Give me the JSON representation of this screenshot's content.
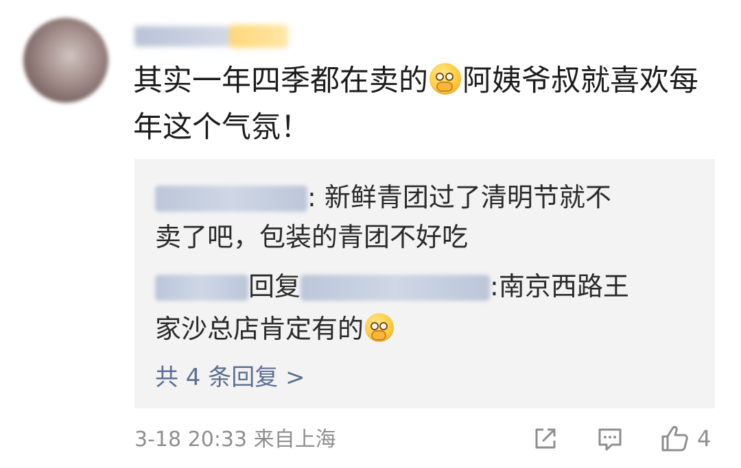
{
  "comment": {
    "username": "",
    "text_part1": "其实一年四季都在卖的",
    "text_part2": "阿姨爷叔就喜欢每年这个气氛！",
    "emoji": "thinking-emoji"
  },
  "replies": [
    {
      "line1": ": 新鲜青团过了清明节就不",
      "line2": "卖了吧，包装的青团不好吃"
    },
    {
      "reply_word": "回复",
      "line1_suffix": ":南京西路王",
      "line2": "家沙总店肯定有的",
      "emoji": "thinking-emoji"
    }
  ],
  "more_replies_label": "共 4 条回复 >",
  "meta": {
    "date": "3-18",
    "time": "20:33",
    "location": "来自上海"
  },
  "actions": {
    "share_icon": "share-icon",
    "comment_icon": "comment-icon",
    "like_icon": "thumbs-up-icon",
    "like_count": "4"
  },
  "colors": {
    "link": "#5a6f8f",
    "meta": "#8e8e8e",
    "reply_bg": "#f3f3f3"
  }
}
